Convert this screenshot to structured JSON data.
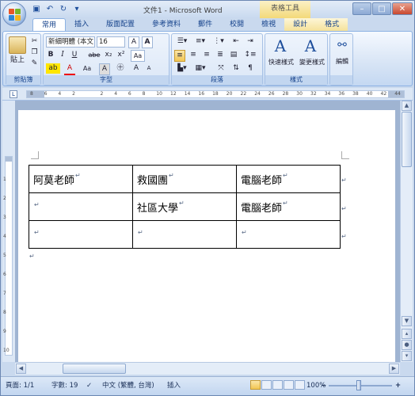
{
  "window": {
    "title": "文件1 - Microsoft Word",
    "contextual_title": "表格工具",
    "controls": [
      "–",
      "□",
      "✕"
    ]
  },
  "qat": [
    "save-icon",
    "undo-icon",
    "redo-icon",
    "customize-icon"
  ],
  "tabs": [
    "常用",
    "插入",
    "版面配置",
    "參考資料",
    "郵件",
    "校閱",
    "檢視",
    "設計",
    "格式"
  ],
  "ribbon": {
    "clipboard": {
      "label": "剪貼簿",
      "paste": "貼上"
    },
    "font": {
      "label": "字型",
      "name": "新細明體 (本文",
      "size": "16",
      "buttons": [
        "B",
        "I",
        "U",
        "abe",
        "x₂",
        "x²",
        "Aa",
        "A",
        "A",
        "A"
      ]
    },
    "paragraph": {
      "label": "段落"
    },
    "styles": {
      "label": "樣式",
      "quick": "快速樣式",
      "change": "變更樣式"
    },
    "editing": {
      "label": "編輯"
    }
  },
  "ruler_numbers": [
    "8",
    "6",
    "4",
    "2",
    "",
    "2",
    "4",
    "6",
    "8",
    "10",
    "12",
    "14",
    "16",
    "18",
    "20",
    "22",
    "24",
    "26",
    "28",
    "30",
    "32",
    "34",
    "36",
    "38",
    "40",
    "42",
    "44"
  ],
  "left_ruler_numbers": [
    "1",
    "2",
    "3",
    "4",
    "5",
    "6",
    "7",
    "8",
    "9",
    "10"
  ],
  "document": {
    "table": [
      [
        "阿莫老師",
        "救國團",
        "電腦老師"
      ],
      [
        "",
        "社區大學",
        "電腦老師"
      ],
      [
        "",
        "",
        ""
      ]
    ],
    "mark": "↵"
  },
  "status": {
    "page": "頁面: 1/1",
    "words": "字數: 19",
    "language": "中文 (繁體, 台灣)",
    "mode": "插入",
    "zoom": "100%"
  }
}
